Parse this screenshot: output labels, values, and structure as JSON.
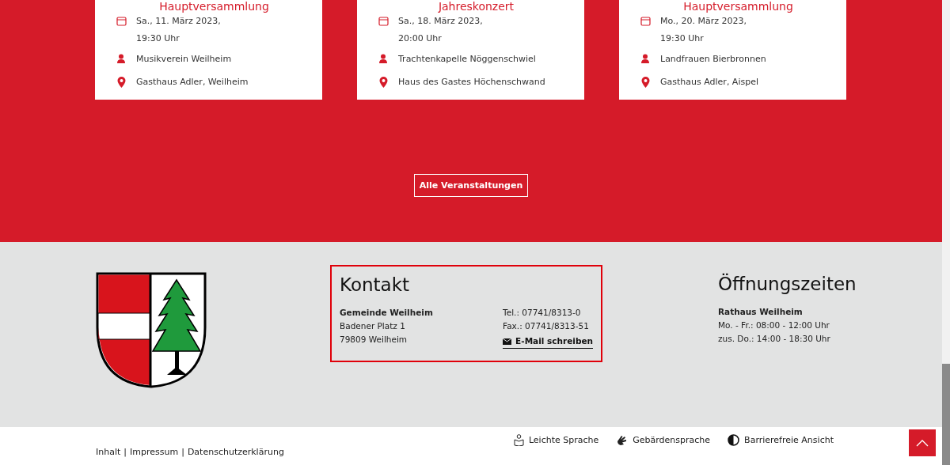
{
  "events": [
    {
      "title": "Hauptversammlung",
      "date": "Sa., 11. März 2023,",
      "time": "19:30 Uhr",
      "organizer": "Musikverein Weilheim",
      "location": "Gasthaus Adler, Weilheim"
    },
    {
      "title": "Jahreskonzert",
      "date": "Sa., 18. März 2023,",
      "time": "20:00 Uhr",
      "organizer": "Trachtenkapelle Nöggenschwiel",
      "location": "Haus des Gastes Höchenschwand"
    },
    {
      "title": "Hauptversammlung",
      "date": "Mo., 20. März 2023,",
      "time": "19:30 Uhr",
      "organizer": "Landfrauen Bierbronnen",
      "location": "Gasthaus Adler, Aispel"
    }
  ],
  "all_events_button": "Alle Veranstaltungen",
  "contact": {
    "heading": "Kontakt",
    "name": "Gemeinde Weilheim",
    "street": "Badener Platz 1",
    "city": "79809 Weilheim",
    "phone": "Tel.: 07741/8313-0",
    "fax": "Fax.: 07741/8313-51",
    "email_link": "E-Mail schreiben"
  },
  "hours": {
    "heading": "Öffnungszeiten",
    "name": "Rathaus Weilheim",
    "lines": [
      "Mo. - Fr.: 08:00 - 12:00 Uhr",
      "zus. Do.: 14:00 - 18:30 Uhr"
    ]
  },
  "footer_links": [
    "Inhalt",
    "Impressum",
    "Datenschutzerklärung"
  ],
  "footer_separator": "|",
  "accessibility_links": [
    {
      "kind": "easy",
      "label": "Leichte Sprache"
    },
    {
      "kind": "sign",
      "label": "Gebärdensprache"
    },
    {
      "kind": "contrast",
      "label": "Barrierefreie Ansicht"
    }
  ]
}
